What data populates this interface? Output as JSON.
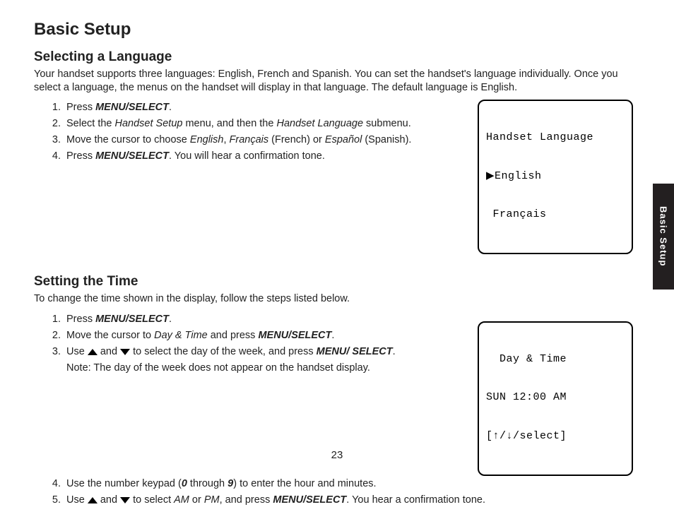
{
  "page": {
    "title": "Basic Setup",
    "number": "23",
    "tab_label": "Basic Setup"
  },
  "section_lang": {
    "heading": "Selecting a Language",
    "intro": "Your handset supports three languages: English, French and Spanish. You can set the handset's language individually. Once you select a language, the menus on the handset will display in that language. The default language is English.",
    "steps": {
      "s1_a": "Press ",
      "s1_b": "MENU/SELECT",
      "s1_c": ".",
      "s2_a": "Select the ",
      "s2_b": "Handset Setup",
      "s2_c": " menu, and then the ",
      "s2_d": "Handset Language",
      "s2_e": " submenu.",
      "s3_a": "Move the cursor to choose ",
      "s3_b": "English",
      "s3_c": ", ",
      "s3_d": "Français",
      "s3_e": " (French) or ",
      "s3_f": "Español",
      "s3_g": " (Spanish).",
      "s4_a": "Press ",
      "s4_b": "MENU/SELECT",
      "s4_c": ". You will hear a confirmation tone."
    },
    "lcd": {
      "l1": "Handset Language",
      "l2": "▶English",
      "l3": " Français"
    }
  },
  "section_time": {
    "heading": "Setting the Time",
    "intro": "To change the time shown in the display, follow the steps listed below.",
    "steps": {
      "s1_a": "Press ",
      "s1_b": "MENU/SELECT",
      "s1_c": ".",
      "s2_a": "Move the cursor to ",
      "s2_b": "Day & Time",
      "s2_c": " and press ",
      "s2_d": "MENU/SELECT",
      "s2_e": ".",
      "s3_a": "Use ",
      "s3_b": " and ",
      "s3_c": " to select the day of the week, and press ",
      "s3_d": "MENU/ SELECT",
      "s3_e": ".",
      "s3_note": "Note: The day of the week does not appear on the handset display.",
      "s4_a": "Use the number keypad (",
      "s4_b": "0",
      "s4_c": " through ",
      "s4_d": "9",
      "s4_e": ") to enter the hour and minutes.",
      "s5_a": "Use ",
      "s5_b": " and ",
      "s5_c": " to select ",
      "s5_d": "AM",
      "s5_e": " or ",
      "s5_f": "PM",
      "s5_g": ", and press ",
      "s5_h": "MENU/SELECT",
      "s5_i": ". You hear a confirmation tone."
    },
    "lcd": {
      "l1": "  Day & Time",
      "l2": "SUN 12:00 AM",
      "l3": "[↑/↓/select]"
    }
  }
}
